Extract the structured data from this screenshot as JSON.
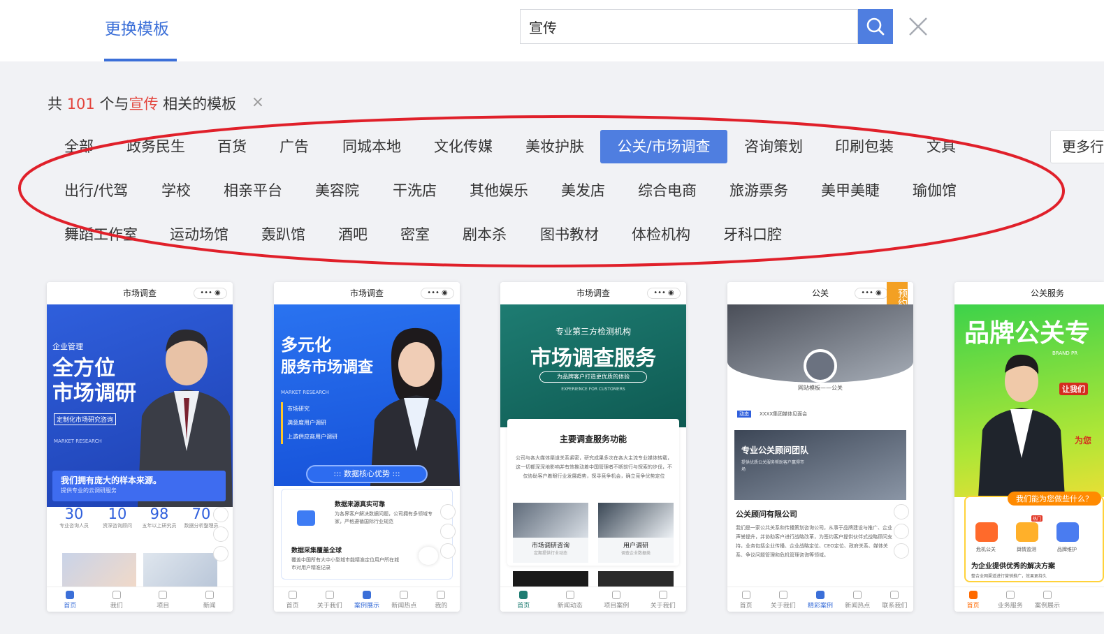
{
  "header": {
    "tab_label": "更换模板",
    "search_value": "宣传"
  },
  "summary": {
    "prefix": "共",
    "count": "101",
    "middle": "个与",
    "keyword": "宣传",
    "suffix": "相关的模板"
  },
  "categories": {
    "row1": [
      "全部",
      "政务民生",
      "百货",
      "广告",
      "同城本地",
      "文化传媒",
      "美妆护肤",
      "公关/市场调查",
      "咨询策划",
      "印刷包装",
      "文具"
    ],
    "row2": [
      "出行/代驾",
      "学校",
      "相亲平台",
      "美容院",
      "干洗店",
      "其他娱乐",
      "美发店",
      "综合电商",
      "旅游票务",
      "美甲美睫",
      "瑜伽馆"
    ],
    "row3": [
      "舞蹈工作室",
      "运动场馆",
      "轰趴馆",
      "酒吧",
      "密室",
      "剧本杀",
      "图书教材",
      "体检机构",
      "牙科口腔"
    ],
    "active": "公关/市场调查",
    "more_label": "更多行"
  },
  "cards": [
    {
      "title": "市场调查",
      "caps": "••• ◉",
      "tag": "企业管理",
      "headline1": "全方位",
      "headline2": "市场调研",
      "sub": "定制化市场研究咨询",
      "sub2": "MARKET RESEARCH",
      "banner": "我们拥有庞大的样本来源。",
      "banner_sub": "提供专业的云调研服务",
      "stats": [
        {
          "num": "30",
          "label": "专业咨询人员"
        },
        {
          "num": "10",
          "label": "资深咨询顾问"
        },
        {
          "num": "98",
          "label": "五年以上研究员"
        },
        {
          "num": "70",
          "label": "数据分析整理员"
        }
      ],
      "nav": [
        "首页",
        "我们",
        "项目",
        "新闻"
      ]
    },
    {
      "title": "市场调查",
      "caps": "••• ◉",
      "headline1": "多元化",
      "headline2": "服务市场调查",
      "sub": "MARKET RESEARCH",
      "items": [
        "市场研究",
        "满意度用户调研",
        "上游供应商用户调研"
      ],
      "banner": "::: 数据核心优势 :::",
      "feature1": "数据来源真实可靠",
      "feature1_desc": "为各界客户解决数据问题，公司拥有多领域专家，严格遵循国际行业规范",
      "feature2": "数据采集覆盖全球",
      "feature2_desc": "覆盖中国所有大中小型城市能精准定位用户所在城市对用户精准记录",
      "nav": [
        "首页",
        "关于我们",
        "案例展示",
        "新闻热点",
        "我的"
      ]
    },
    {
      "title": "市场调查",
      "caps": "••• ◉",
      "sub_top": "专业第三方检测机构",
      "headline1": "市场调查服务",
      "pill": "为品牌客户打造更优质的体验",
      "sub2": "EXPERIENCE FOR CUSTOMERS",
      "section": "主要调查服务功能",
      "desc": "公司与各大媒体渠道关系紧密，研究成果多次在各大主流专业媒体转载，这一切都深深地影响并有效推动着中国管理者不断前行与探索的步伐，不仅协助客户着眼行业发展趋势，探寻竞争机会，确立竞争优势定位",
      "tile1": "市场调研咨询",
      "tile1_sub": "定期提供行业动态",
      "tile2": "用户调研",
      "tile2_sub": "调查企业数据类",
      "nav": [
        "首页",
        "新闻动态",
        "项目案例",
        "关于我们"
      ]
    },
    {
      "title": "公关",
      "caps": "••• ◉",
      "ribbon": "预约",
      "brand": "网站模板——公关",
      "notice_tag": "动态",
      "notice": "XXXX集团媒体见面会",
      "team": "专业公关顾问团队",
      "team_sub": "提供优质公关服务帮助客户赢得市场",
      "company": "公关顾问有限公司",
      "company_desc": "我们是一家公共关系和传播策划咨询公司，从事于品牌建设与推广、企业声誉提升，并协助客户进行战略改革，为签约客户提供伙伴式战略顾问支持，业务包括企业传播、企业战略定位、CEO定位、政府关系、媒体关系、争议问题管理和危机管理咨询等领域。",
      "nav": [
        "首页",
        "关于我们",
        "精彩案例",
        "新闻热点",
        "联系我们"
      ]
    },
    {
      "title": "公关服务",
      "caps": "",
      "headline1": "品牌公关专",
      "sub": "BRAND PR",
      "badge": "让我们",
      "side": "为您",
      "question": "我们能为您做些什么？",
      "icons": [
        "危机公关",
        "舆情监测",
        "品牌维护"
      ],
      "hot": "热门",
      "solution": "为企业提供优秀的解决方案",
      "solution_sub": "整合全网渠道进行营销推广，效果更持久",
      "nav": [
        "首页",
        "业务服务",
        "案例展示"
      ]
    }
  ]
}
